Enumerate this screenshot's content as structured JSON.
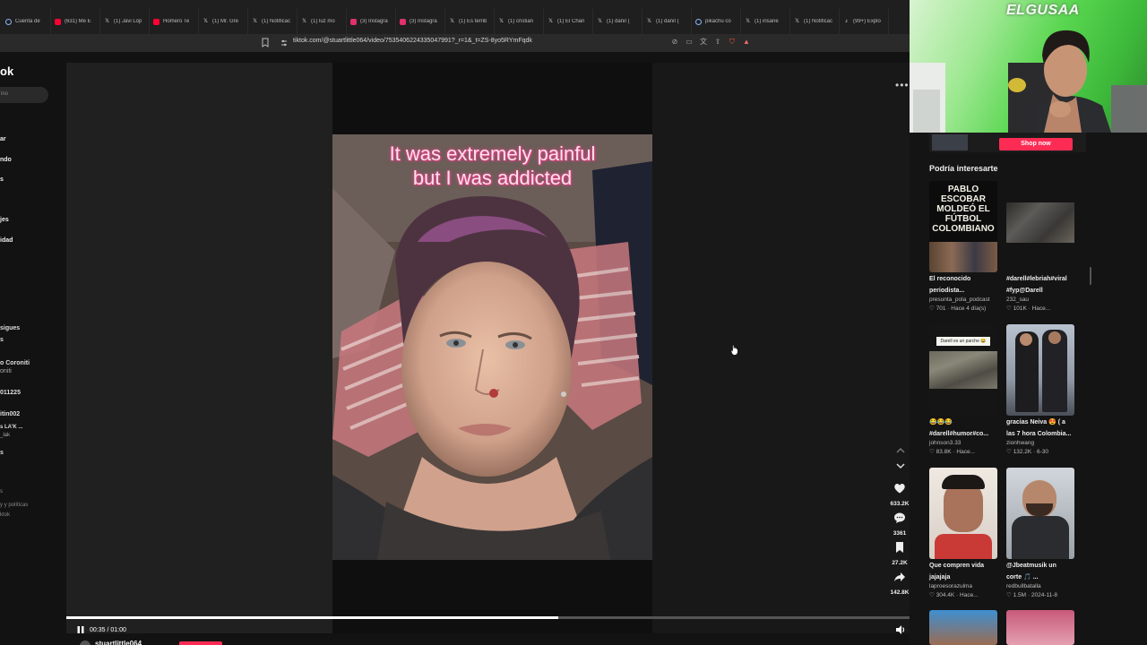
{
  "browser": {
    "tabs": [
      {
        "label": "Cuenta de",
        "icon": "google-icon",
        "color": "#8ab4f8"
      },
      {
        "label": "(631) Me E",
        "icon": "youtube-icon",
        "color": "#ff0033"
      },
      {
        "label": "(1) Javi Lóp",
        "icon": "x-icon",
        "color": "#dddddd"
      },
      {
        "label": "Homero Te",
        "icon": "youtube-icon",
        "color": "#ff0033"
      },
      {
        "label": "(1) Mr. Gre",
        "icon": "x-icon",
        "color": "#dddddd"
      },
      {
        "label": "(1) Notificac",
        "icon": "x-icon",
        "color": "#dddddd"
      },
      {
        "label": "(1) luz mo",
        "icon": "x-icon",
        "color": "#dddddd"
      },
      {
        "label": "(3) Instagra",
        "icon": "instagram-icon",
        "color": "#e1306c"
      },
      {
        "label": "(3) Instagra",
        "icon": "instagram-icon",
        "color": "#e1306c"
      },
      {
        "label": "(1) Es terrib",
        "icon": "x-icon",
        "color": "#dddddd"
      },
      {
        "label": "(1) cristian",
        "icon": "x-icon",
        "color": "#dddddd"
      },
      {
        "label": "(1) El Chan",
        "icon": "x-icon",
        "color": "#dddddd"
      },
      {
        "label": "(1) daniI (",
        "icon": "x-icon",
        "color": "#dddddd"
      },
      {
        "label": "(1) daniI (",
        "icon": "x-icon",
        "color": "#dddddd"
      },
      {
        "label": "pikachu co",
        "icon": "google-icon",
        "color": "#8ab4f8"
      },
      {
        "label": "(1) insane",
        "icon": "x-icon",
        "color": "#dddddd"
      },
      {
        "label": "(1) Notificac",
        "icon": "x-icon",
        "color": "#dddddd"
      },
      {
        "label": "(99+) Explo",
        "icon": "tiktok-icon",
        "color": "#ffffff"
      }
    ],
    "url": "tiktok.com/@stuartlittle064/video/7535406224335047991?_r=1&_t=ZS-8yo5RYmFqdk"
  },
  "sidebar": {
    "logo": "ok",
    "search_placeholder": "ino",
    "nav": [
      "ar",
      "ndo",
      "s",
      "jes",
      "idad"
    ],
    "following": [
      "sigues",
      "s",
      "o Coroniti",
      "oniti",
      "011225",
      "itin002",
      "s LA'K ...",
      "_lak",
      "s"
    ],
    "footer": [
      "s",
      "y y políticas",
      "ktok"
    ]
  },
  "player": {
    "caption_line1": "It was extremely painful",
    "caption_line2": "but I was addicted",
    "time": "00:35 / 01:00",
    "progress": 0.5833,
    "author": "stuartlittle064",
    "likes": "633.2K",
    "comments": "3361",
    "saves": "27.2K",
    "shares": "142.8K"
  },
  "webcam": {
    "logo": "ELGUSAA"
  },
  "right_panel": {
    "shop_button": "Shop now",
    "heading": "Podría interesarte",
    "cards": [
      {
        "title1": "El reconocido",
        "title2": "periodista...",
        "author": "presunta_pola_podcast",
        "meta": "♡ 701 · Hace 4 día(s)",
        "thumb_text1": "PABLO ESCOBAR",
        "thumb_text2": "MOLDEÓ EL",
        "thumb_text3": "FÚTBOL",
        "thumb_text4": "COLOMBIANO"
      },
      {
        "title1": "#darell#lebriah#viral",
        "title2": "#fyp@Darell",
        "author": "232_sau",
        "meta": "♡ 101K · Hace..."
      },
      {
        "title1": "😂😂😂",
        "title2": "#darell#humor#co...",
        "author": "johnson3.33",
        "meta": "♡ 83.8K · Hace...",
        "thumb_text1": "Darell es un parche 😂"
      },
      {
        "title1": "gracias Neiva 😍 ( a",
        "title2": "las 7 hora Colombia...",
        "author": "zionhwang",
        "meta": "♡ 132.2K · 6-30"
      },
      {
        "title1": "Que compren vida",
        "title2": "jajajaja",
        "author": "laproesorazulma",
        "meta": "♡ 304.4K · Hace..."
      },
      {
        "title1": "@Jbeatmusik un",
        "title2": "corte 🎵 ...",
        "author": "redbullbatalla",
        "meta": "♡ 1.5M · 2024-11-8"
      }
    ]
  }
}
